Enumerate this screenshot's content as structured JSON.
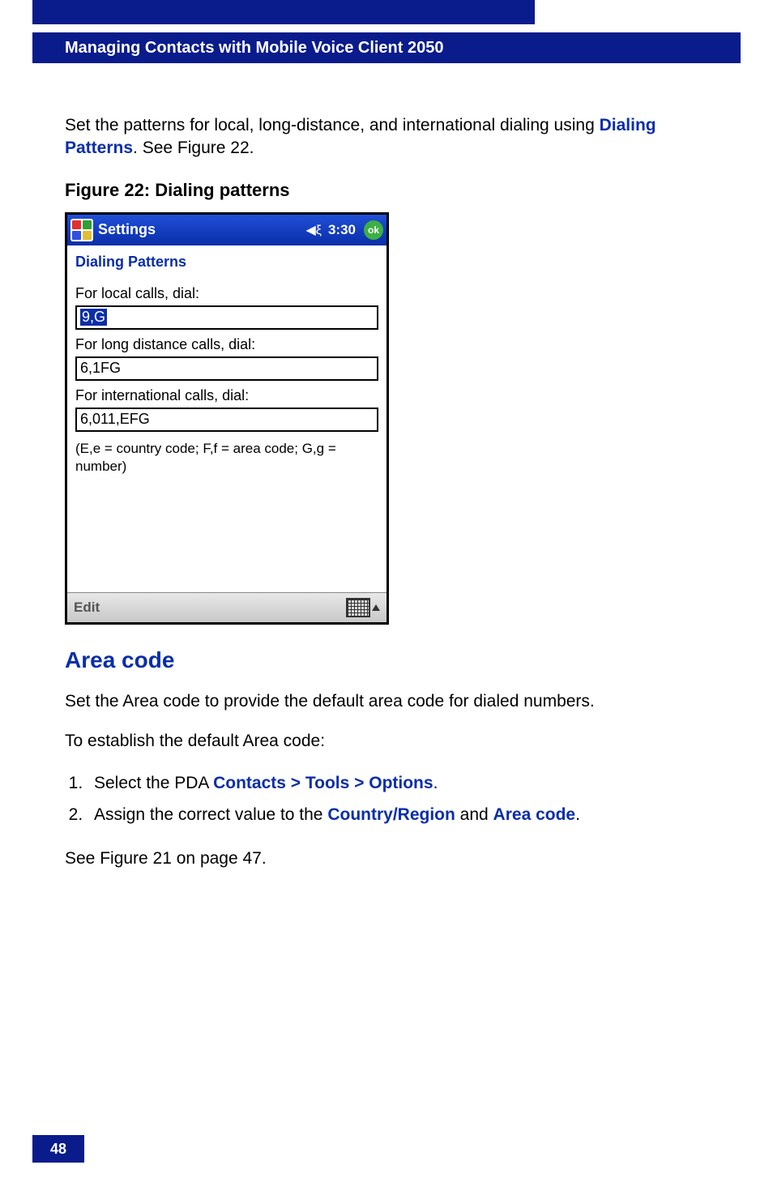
{
  "header": {
    "title": "Managing Contacts with Mobile Voice Client 2050"
  },
  "intro": {
    "text_before": "Set the patterns for local, long-distance, and international dialing using ",
    "link": "Dialing Patterns",
    "text_after": ". See Figure 22."
  },
  "figure": {
    "caption": "Figure 22: Dialing patterns"
  },
  "screenshot": {
    "titlebar": {
      "title": "Settings",
      "time": "3:30",
      "ok": "ok"
    },
    "app_title": "Dialing Patterns",
    "local_label": "For local calls, dial:",
    "local_value": "9,G",
    "long_label": "For long distance calls, dial:",
    "long_value": "6,1FG",
    "intl_label": "For international calls, dial:",
    "intl_value": "6,011,EFG",
    "hint": "(E,e = country code; F,f = area code; G,g = number)",
    "menu_edit": "Edit"
  },
  "section": {
    "heading": "Area code",
    "para1": "Set the Area code to provide the default area code for dialed numbers.",
    "para2": "To establish the default Area code:",
    "step1_a": "Select the PDA ",
    "step1_b": "Contacts > Tools > Options",
    "step1_c": ".",
    "step2_a": "Assign the correct value to the ",
    "step2_b": "Country/Region",
    "step2_c": " and ",
    "step2_d": "Area code",
    "step2_e": ".",
    "see": "See Figure 21 on page 47."
  },
  "footer": {
    "page": "48"
  }
}
